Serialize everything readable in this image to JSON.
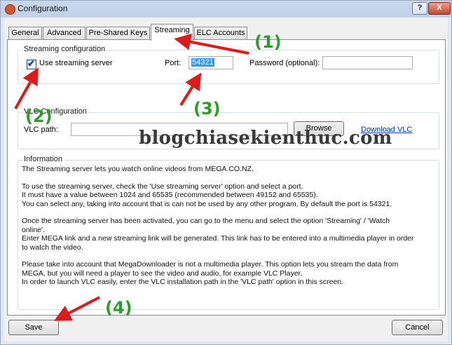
{
  "window": {
    "title": "Configuration",
    "help_label": "?",
    "close_label": "X"
  },
  "tabs": [
    {
      "label": "General"
    },
    {
      "label": "Advanced"
    },
    {
      "label": "Pre-Shared Keys"
    },
    {
      "label": "Streaming",
      "active": true
    },
    {
      "label": "ELC Accounts"
    }
  ],
  "streaming": {
    "group_title": "Streaming configuration",
    "use_server_label": "Use streaming server",
    "use_server_checked": true,
    "port_label": "Port:",
    "port_value": "54321",
    "password_label": "Password (optional):",
    "password_value": ""
  },
  "vlc": {
    "group_title": "VLC Configuration",
    "path_label": "VLC path:",
    "path_value": "",
    "browse_label": "Browse",
    "download_label": "Download VLC"
  },
  "information": {
    "group_title": "Information",
    "lines": [
      "The Streaming server lets you watch online videos from MEGA.CO.NZ.",
      "",
      "To use the streaming server, check the 'Use streaming server' option and select a port.",
      "It must have a value between 1024 and 65535 (recommended between 49152 and 65535).",
      "You can select any, taking into account that is can not be used by any other program. By default the port is 54321.",
      "",
      "Once the streaming server has been activated, you can go to the menu and select the option 'Streaming' / 'Watch",
      "online'.",
      "Enter MEGA link and a new streaming link will be generated. This link has to be entered into a multimedia player in order",
      "to watch the video.",
      "",
      "Please take into account that MegaDownloader is not a multimedia player. This option lets you stream the data from",
      "MEGA, but you will need a player to see the video and audio, for example VLC Player.",
      "In order to launch VLC easily, enter the VLC installation path in the 'VLC path' option in this screen."
    ]
  },
  "footer": {
    "save_label": "Save",
    "cancel_label": "Cancel"
  },
  "overlay": {
    "watermark": "blogchiasekienthuc.com",
    "annotations": [
      "(1)",
      "(2)",
      "(3)",
      "(4)"
    ],
    "arrow_color": "#e0191a",
    "annotation_color": "#2a9d2a"
  }
}
